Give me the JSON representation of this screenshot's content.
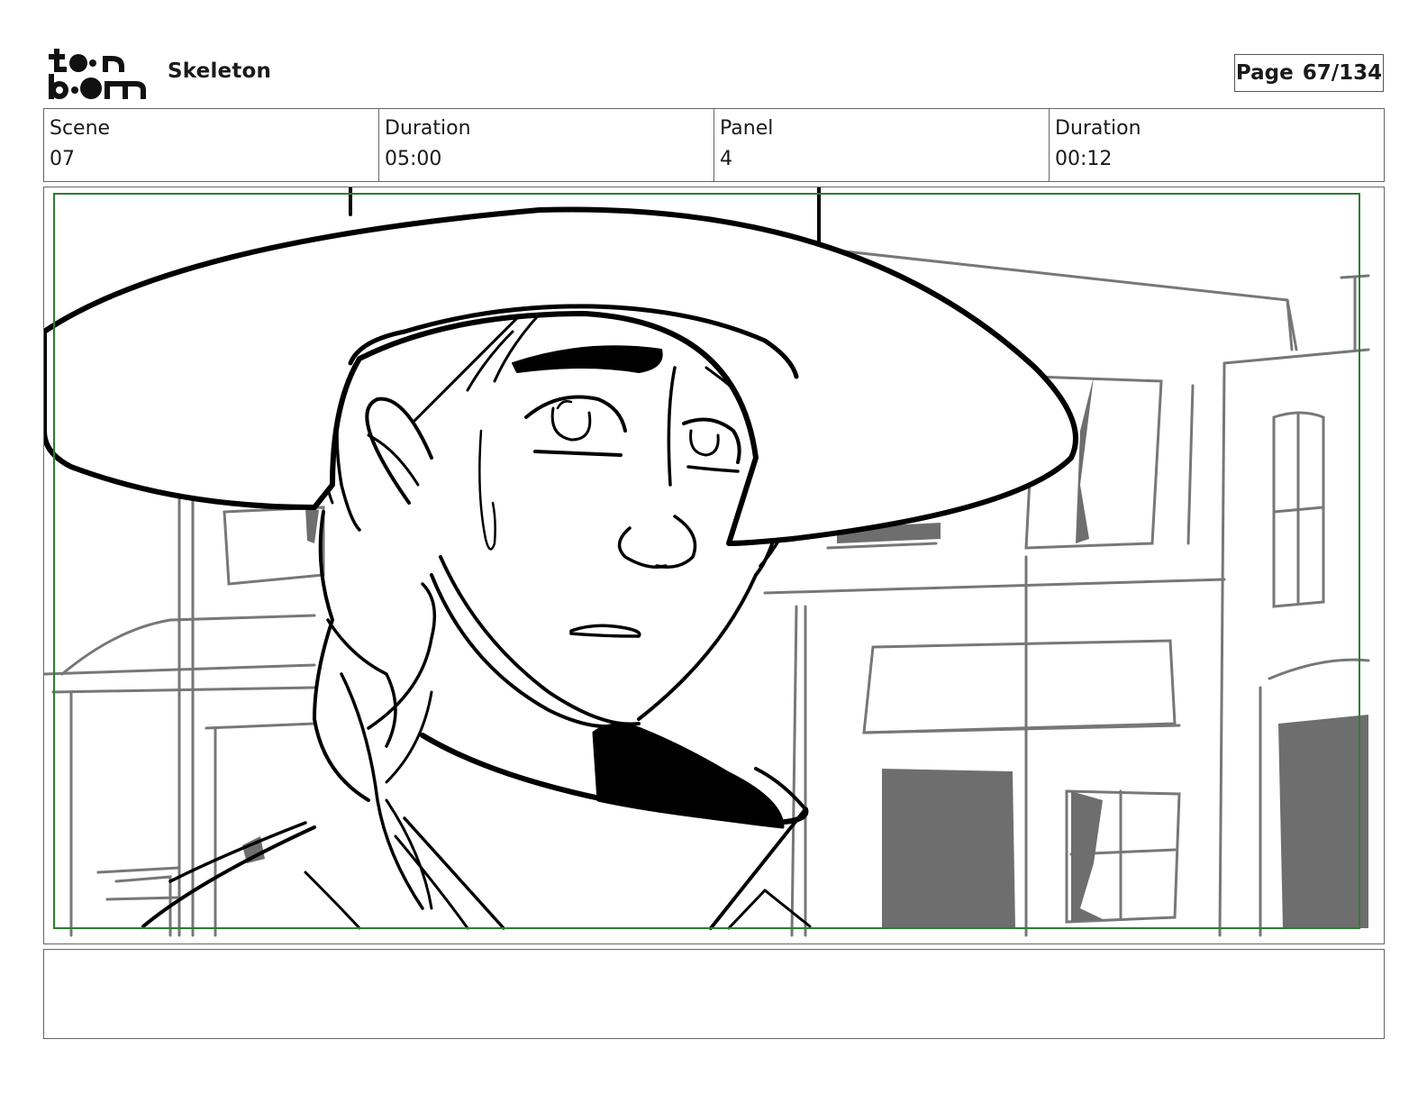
{
  "header": {
    "logo_alt": "toon boom",
    "project_title": "Skeleton",
    "page_label": "Page",
    "page_number": "67/134"
  },
  "info": {
    "scene_label": "Scene",
    "scene_value": "07",
    "scene_duration_label": "Duration",
    "scene_duration_value": "05:00",
    "panel_label": "Panel",
    "panel_value": "4",
    "panel_duration_label": "Duration",
    "panel_duration_value": "00:12"
  },
  "panel": {
    "frame_color": "#2e7d32",
    "line_color": "#000000",
    "background_line_color": "#777777"
  },
  "notes": {
    "text": ""
  }
}
